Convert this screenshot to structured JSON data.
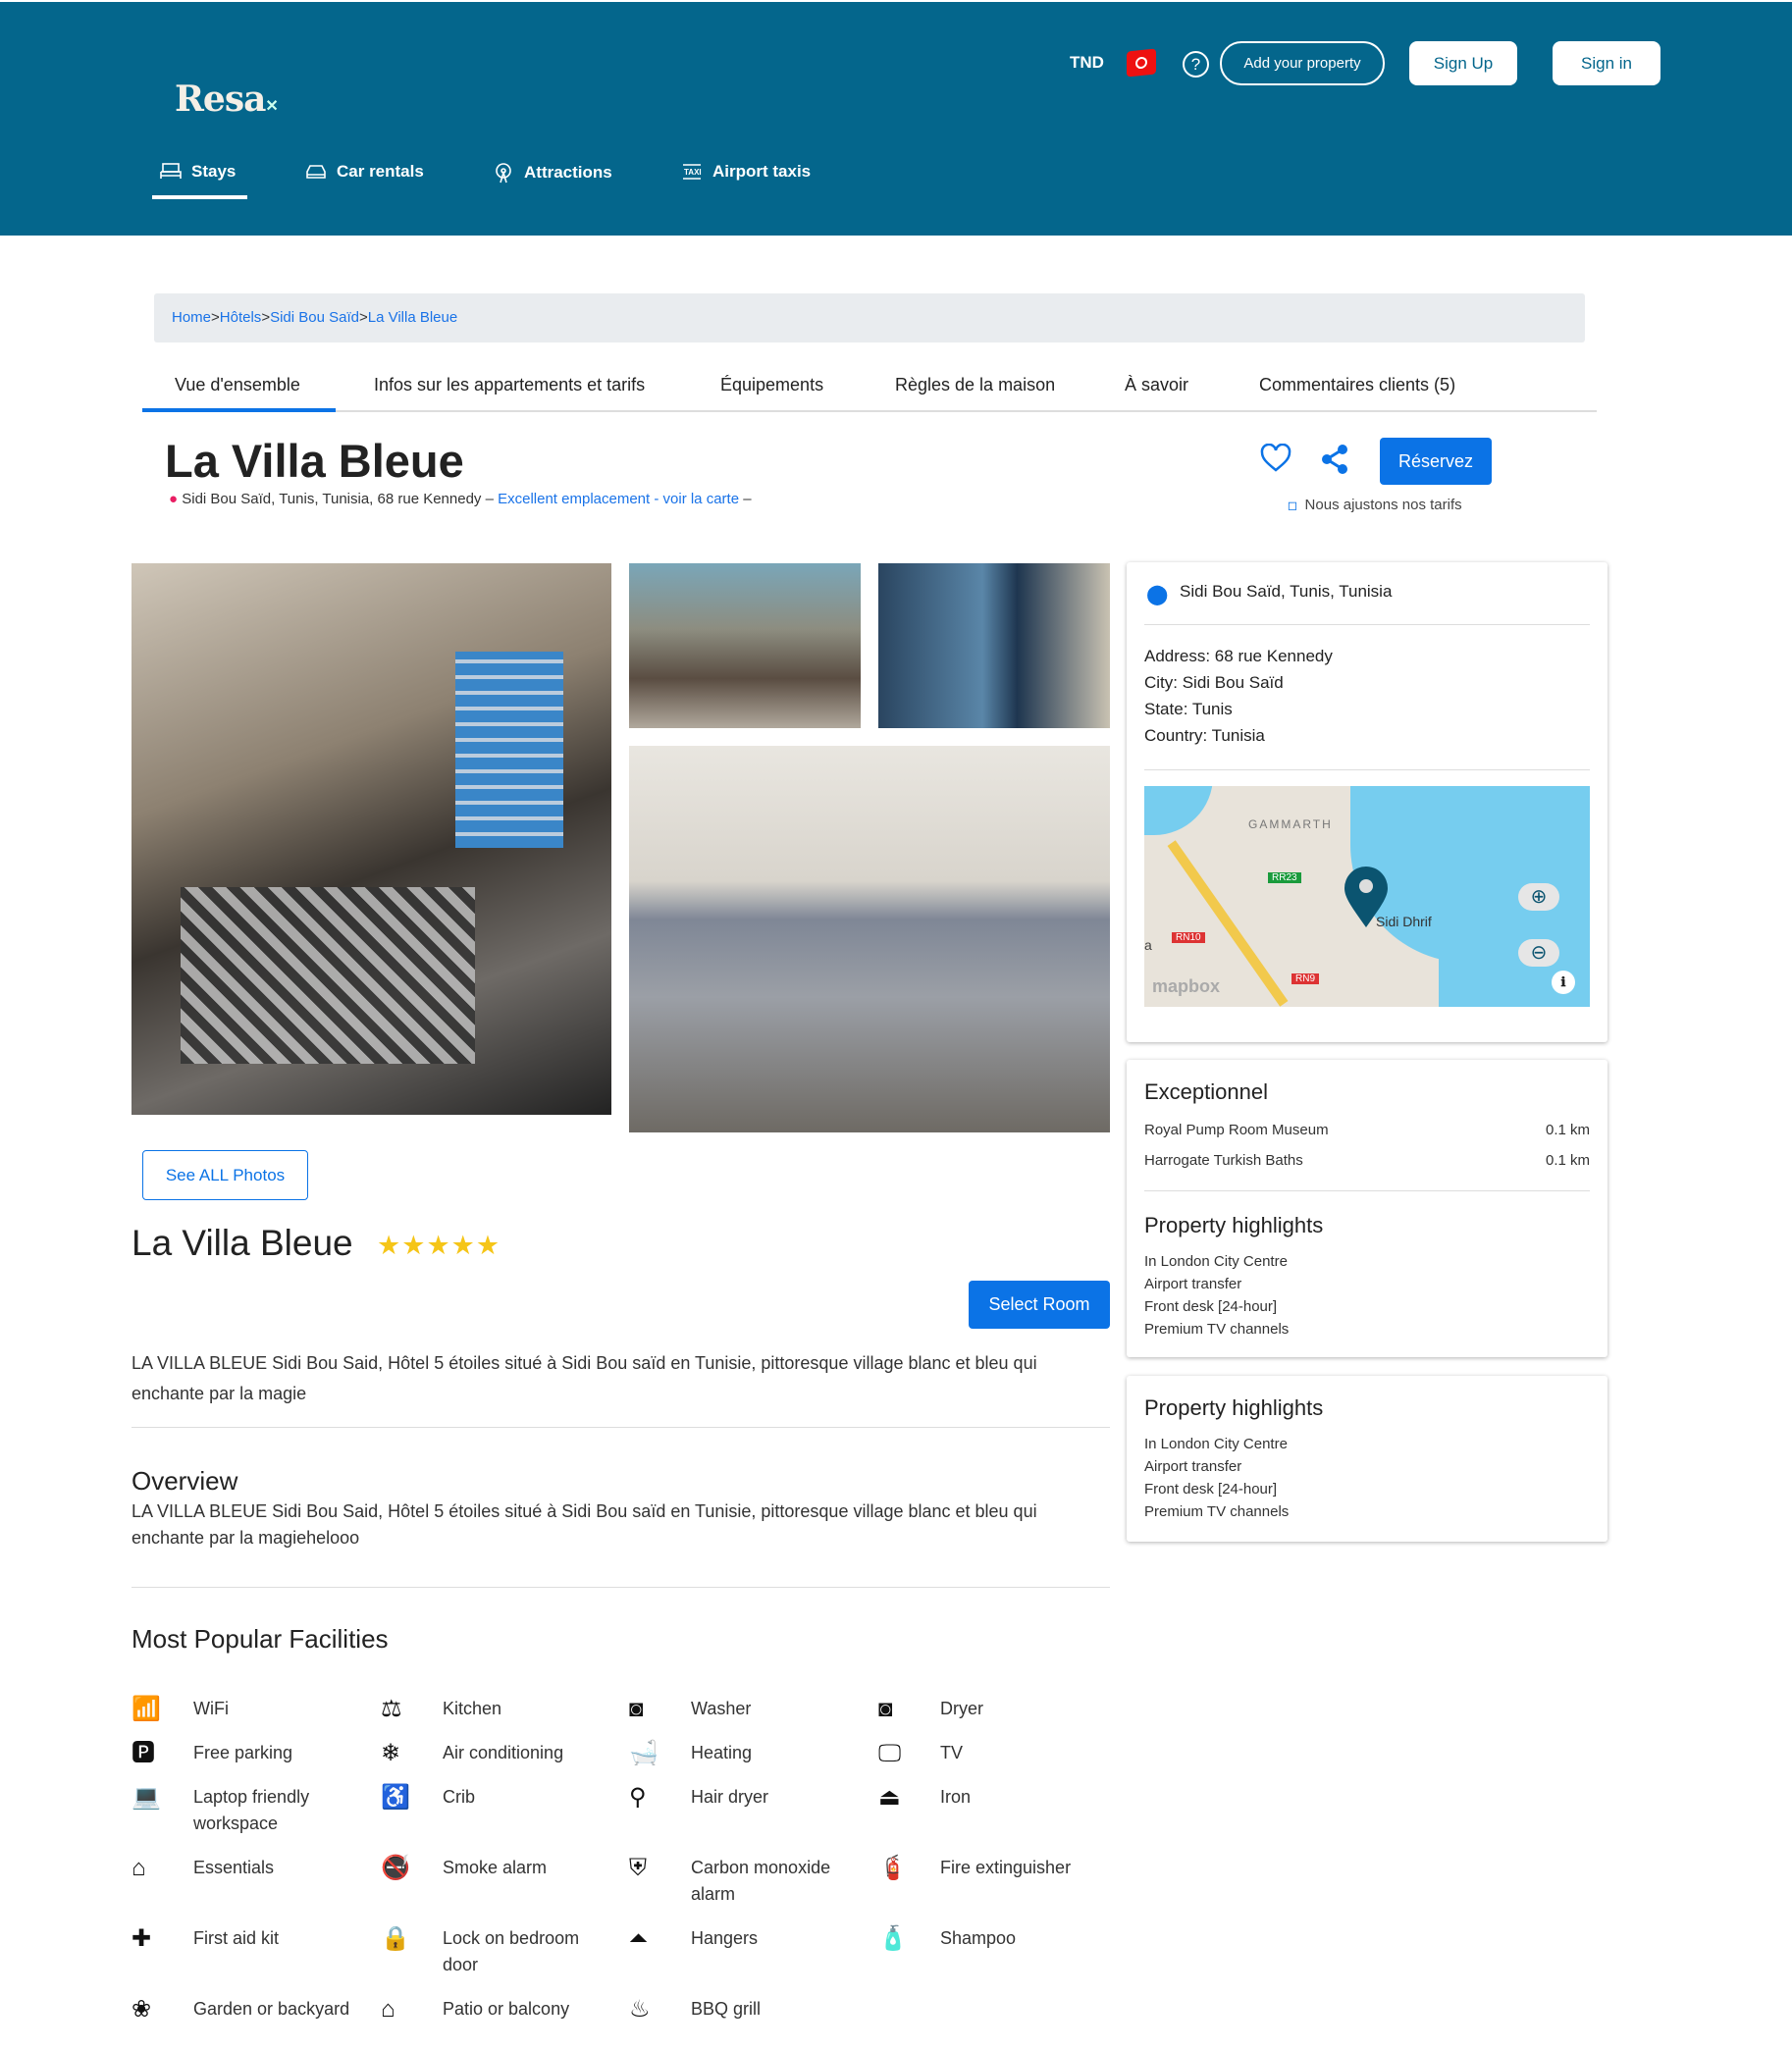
{
  "header": {
    "logo": "Resa",
    "currency": "TND",
    "add_property": "Add your property",
    "sign_up": "Sign Up",
    "sign_in": "Sign in",
    "nav": [
      {
        "label": "Stays",
        "icon": "bed-icon"
      },
      {
        "label": "Car rentals",
        "icon": "car-icon"
      },
      {
        "label": "Attractions",
        "icon": "attractions-icon"
      },
      {
        "label": "Airport taxis",
        "icon": "taxi-icon"
      }
    ]
  },
  "breadcrumb": [
    "Home",
    "Hôtels",
    "Sidi Bou Saïd",
    "La Villa Bleue"
  ],
  "tabs": [
    "Vue d'ensemble",
    "Infos sur les appartements et tarifs",
    "Équipements",
    "Règles de la maison",
    "À savoir",
    "Commentaires clients (5)"
  ],
  "property": {
    "title": "La Villa Bleue",
    "address_line": "Sidi Bou Saïd, Tunis, Tunisia, 68 rue Kennedy –",
    "location_link": "Excellent emplacement - voir la carte",
    "dash": "–",
    "reserve": "Réservez",
    "price_note": "Nous ajustons nos tarifs",
    "see_photos": "See ALL Photos",
    "stars": 5,
    "select_room": "Select Room",
    "description": "LA VILLA BLEUE Sidi Bou Said, Hôtel 5 étoiles situé à Sidi Bou saïd en Tunisie, pittoresque village blanc et bleu qui enchante par la magie",
    "overview_title": "Overview",
    "overview": "LA VILLA BLEUE Sidi Bou Said, Hôtel 5 étoiles situé à Sidi Bou saïd en Tunisie, pittoresque village blanc et bleu qui enchante par la magiehelooo"
  },
  "location_card": {
    "title": "Sidi Bou Saïd, Tunis, Tunisia",
    "address": "Address: 68 rue Kennedy",
    "city": "City: Sidi Bou Saïd",
    "state": "State: Tunis",
    "country": "Country: Tunisia",
    "map": {
      "labels": [
        "GAMMARTH",
        "Sidi Dhrif",
        "RR23",
        "RN10",
        "RN9",
        "a"
      ],
      "attribution": "mapbox"
    }
  },
  "nearby": {
    "title": "Exceptionnel",
    "items": [
      {
        "name": "Royal Pump Room Museum",
        "dist": "0.1 km"
      },
      {
        "name": "Harrogate Turkish Baths",
        "dist": "0.1 km"
      }
    ]
  },
  "highlights": {
    "title": "Property highlights",
    "items": [
      "In London City Centre",
      "Airport transfer",
      "Front desk [24-hour]",
      "Premium TV channels"
    ]
  },
  "highlights2": {
    "title": "Property highlights",
    "items": [
      "In London City Centre",
      "Airport transfer",
      "Front desk [24-hour]",
      "Premium TV channels"
    ]
  },
  "facilities": {
    "title": "Most Popular Facilities",
    "items": [
      {
        "label": "WiFi",
        "icon": "wifi-icon"
      },
      {
        "label": "Kitchen",
        "icon": "kitchen-scale-icon"
      },
      {
        "label": "Washer",
        "icon": "washer-icon"
      },
      {
        "label": "Dryer",
        "icon": "dryer-icon"
      },
      {
        "label": "Free parking",
        "icon": "parking-icon"
      },
      {
        "label": "Air conditioning",
        "icon": "snowflake-icon"
      },
      {
        "label": "Heating",
        "icon": "bathtub-icon"
      },
      {
        "label": "TV",
        "icon": "tv-icon"
      },
      {
        "label": "Laptop friendly workspace",
        "icon": "laptop-icon"
      },
      {
        "label": "Crib",
        "icon": "crib-icon"
      },
      {
        "label": "Hair dryer",
        "icon": "hair-dryer-icon"
      },
      {
        "label": "Iron",
        "icon": "iron-icon"
      },
      {
        "label": "Essentials",
        "icon": "home-icon"
      },
      {
        "label": "Smoke alarm",
        "icon": "no-smoking-icon"
      },
      {
        "label": "Carbon monoxide alarm",
        "icon": "shield-icon"
      },
      {
        "label": "Fire extinguisher",
        "icon": "fire-extinguisher-icon"
      },
      {
        "label": "First aid kit",
        "icon": "first-aid-icon"
      },
      {
        "label": "Lock on bedroom door",
        "icon": "lock-icon"
      },
      {
        "label": "Hangers",
        "icon": "hanger-icon"
      },
      {
        "label": "Shampoo",
        "icon": "shampoo-icon"
      },
      {
        "label": "Garden or backyard",
        "icon": "garden-icon"
      },
      {
        "label": "Patio or balcony",
        "icon": "patio-icon"
      },
      {
        "label": "BBQ grill",
        "icon": "bbq-icon"
      }
    ]
  },
  "colors": {
    "header": "#04668c",
    "accent": "#0b73e6",
    "star": "#f5c518"
  }
}
